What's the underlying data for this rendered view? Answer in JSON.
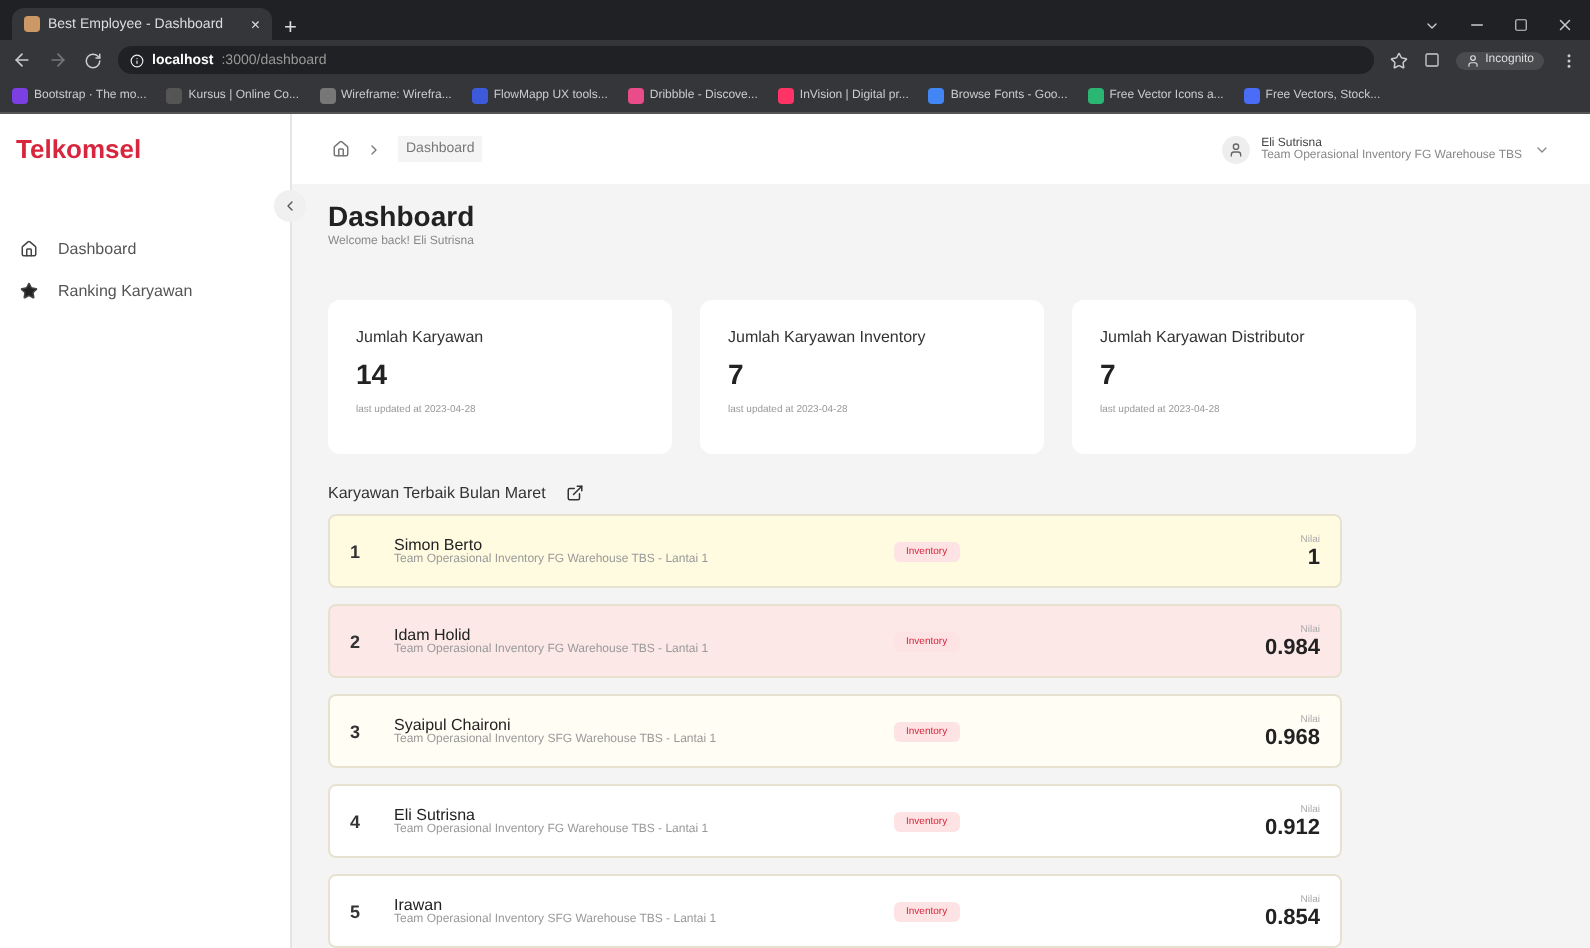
{
  "browser": {
    "tab_title": "Best Employee - Dashboard",
    "tab_close": "×",
    "new_tab": "+",
    "url_host": "localhost",
    "url_path": ":3000/dashboard",
    "profile": "Incognito",
    "bookmarks": [
      "Bootstrap · The mo...",
      "Kursus | Online Co...",
      "Wireframe: Wirefra...",
      "FlowMapp UX tools...",
      "Dribbble - Discove...",
      "InVision | Digital pr...",
      "Browse Fonts - Goo...",
      "Free Vector Icons a...",
      "Free Vectors, Stock..."
    ]
  },
  "sidebar": {
    "logo": "Telkomsel",
    "items": [
      {
        "label": "Dashboard",
        "selected": false
      },
      {
        "label": "Ranking Karyawan",
        "selected": false
      }
    ]
  },
  "header": {
    "breadcrumb": "Dashboard",
    "user_name": "Eli Sutrisna",
    "user_team": "Team Operasional Inventory FG Warehouse TBS"
  },
  "page": {
    "title": "Dashboard",
    "subtitle": "Welcome back! Eli Sutrisna"
  },
  "stats": [
    {
      "label": "Jumlah Karyawan",
      "value": "14",
      "updated": "last updated at 2023-04-28"
    },
    {
      "label": "Jumlah Karyawan Inventory",
      "value": "7",
      "updated": "last updated at 2023-04-28"
    },
    {
      "label": "Jumlah Karyawan Distributor",
      "value": "7",
      "updated": "last updated at 2023-04-28"
    }
  ],
  "ranking": {
    "title": "Karyawan Terbaik Bulan Maret",
    "rows": [
      {
        "rank": "1",
        "name": "Simon Berto",
        "team": "Team Operasional Inventory FG Warehouse TBS - Lantai 1",
        "tag": "Inventory",
        "score_label": "Nilai",
        "score": "1",
        "color": "#fffbe0"
      },
      {
        "rank": "2",
        "name": "Idam Holid",
        "team": "Team Operasional Inventory FG Warehouse TBS - Lantai 1",
        "tag": "Inventory",
        "score_label": "Nilai",
        "score": "0.984",
        "color": "#fde8e8"
      },
      {
        "rank": "3",
        "name": "Syaipul Chaironi",
        "team": "Team Operasional Inventory SFG Warehouse TBS - Lantai 1",
        "tag": "Inventory",
        "score_label": "Nilai",
        "score": "0.968",
        "color": "#fffdf4"
      },
      {
        "rank": "4",
        "name": "Eli Sutrisna",
        "team": "Team Operasional Inventory FG Warehouse TBS - Lantai 1",
        "tag": "Inventory",
        "score_label": "Nilai",
        "score": "0.912",
        "color": "#ffffff"
      },
      {
        "rank": "5",
        "name": "Irawan",
        "team": "Team Operasional Inventory SFG Warehouse TBS - Lantai 1",
        "tag": "Inventory",
        "score_label": "Nilai",
        "score": "0.854",
        "color": "#ffffff"
      }
    ]
  }
}
